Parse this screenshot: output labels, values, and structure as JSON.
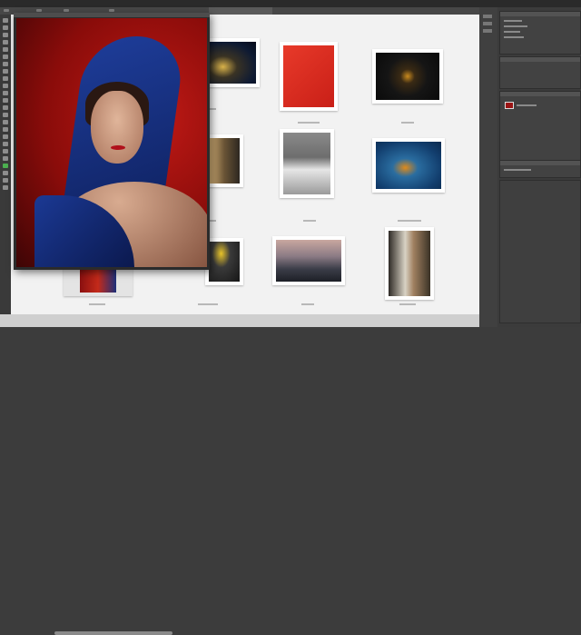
{
  "app": {
    "name": "Image Editor",
    "accent": "#4caf50",
    "background": "#3c3c3c",
    "canvas_background": "#f2f2f2"
  },
  "floating_window": {
    "photo_icon": "portrait-photo-blue-hood-red-background"
  },
  "contact_sheet": {
    "thumbnails": [
      {
        "icon": "night-house-photo"
      },
      {
        "icon": "red-lipsticks-photo"
      },
      {
        "icon": "gold-padlock-photo"
      },
      {
        "icon": "blonde-woman-portrait-photo"
      },
      {
        "icon": "woman-white-coat-photo"
      },
      {
        "icon": "blue-splash-product-photo"
      },
      {
        "icon": "yellow-object-photo"
      },
      {
        "icon": "rocky-seascape-photo"
      },
      {
        "icon": "woman-by-window-photo"
      }
    ]
  },
  "toolbar": {
    "tools": [
      "move-icon",
      "marquee-icon",
      "lasso-icon",
      "wand-icon",
      "crop-icon",
      "eyedropper-icon",
      "heal-icon",
      "brush-icon",
      "stamp-icon",
      "history-brush-icon",
      "eraser-icon",
      "gradient-icon",
      "blur-icon",
      "dodge-icon",
      "pen-icon",
      "type-icon",
      "path-select-icon",
      "shape-icon",
      "hand-icon",
      "zoom-icon",
      "foreground-color-icon",
      "background-color-icon",
      "quick-mask-icon",
      "screen-mode-icon"
    ]
  },
  "panels": {
    "top": {
      "icon": "color-panel-icon"
    },
    "middle": {
      "icon": "properties-panel-icon"
    },
    "layers": {
      "icon": "layers-panel-icon"
    },
    "bottom": {
      "icon": "history-panel-icon"
    }
  }
}
